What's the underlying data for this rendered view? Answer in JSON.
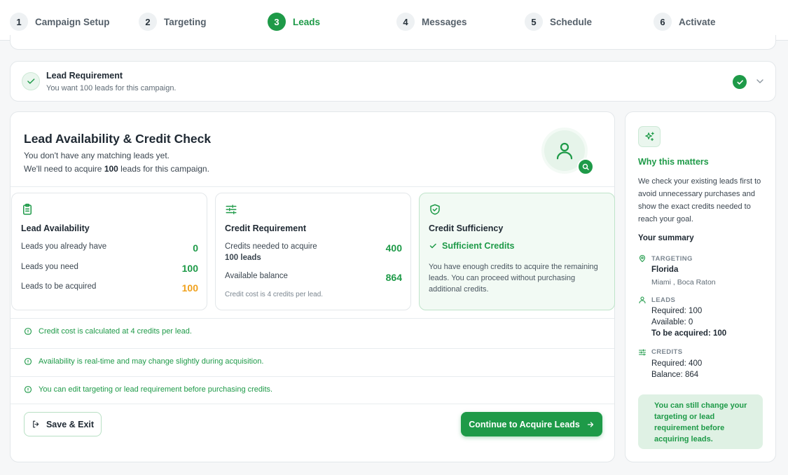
{
  "stepper": {
    "steps": [
      {
        "num": "1",
        "label": "Campaign Setup"
      },
      {
        "num": "2",
        "label": "Targeting"
      },
      {
        "num": "3",
        "label": "Leads"
      },
      {
        "num": "4",
        "label": "Messages"
      },
      {
        "num": "5",
        "label": "Schedule"
      },
      {
        "num": "6",
        "label": "Activate"
      }
    ],
    "active_step": "3"
  },
  "lead_requirement": {
    "title": "Lead Requirement",
    "subtitle": "You want 100 leads for this campaign."
  },
  "main": {
    "title": "Lead Availability & Credit Check",
    "line1": "You don't have any matching leads yet.",
    "line2_pre": "We'll need to acquire ",
    "line2_num": "100",
    "line2_post": " leads for this campaign.",
    "availability": {
      "title": "Lead Availability",
      "rows": [
        {
          "label": "Leads you already have",
          "value": "0"
        },
        {
          "label": "Leads you need",
          "value": "100"
        },
        {
          "label": "Leads to be acquired",
          "value": "100"
        }
      ]
    },
    "credit": {
      "title": "Credit Requirement",
      "needed_label": "Credits needed to acquire",
      "needed_label_bold": "100 leads",
      "needed_value": "400",
      "balance_label": "Available balance",
      "balance_value": "864",
      "note": "Credit cost is 4 credits per lead."
    },
    "sufficiency": {
      "title": "Credit Sufficiency",
      "status": "Sufficient Credits",
      "text": "You have enough credits to acquire the remaining leads. You can proceed without purchasing additional credits."
    },
    "info": [
      "Credit cost is calculated at 4 credits per lead.",
      "Availability is real-time and may change slightly during acquisition.",
      "You can edit targeting or lead requirement before purchasing credits."
    ],
    "save_exit": "Save & Exit",
    "continue": "Continue to Acquire Leads"
  },
  "side": {
    "why_title": "Why this matters",
    "why_text": "We check your existing leads first to avoid unnecessary purchases and show the exact credits needed to reach your goal.",
    "summary_title": "Your summary",
    "targeting": {
      "caption": "TARGETING",
      "state": "Florida",
      "cities": "Miami , Boca Raton"
    },
    "leads": {
      "caption": "LEADS",
      "required": "Required: 100",
      "available": "Available: 0",
      "to_acquire": "To be acquired: 100"
    },
    "credits": {
      "caption": "CREDITS",
      "required": "Required: 400",
      "balance": "Balance: 864"
    },
    "tip": "You can still change your targeting or lead requirement before acquiring leads."
  },
  "colors": {
    "accent": "#1e9a48",
    "warning": "#f0a11c",
    "info_bg": "#dff1e4"
  }
}
